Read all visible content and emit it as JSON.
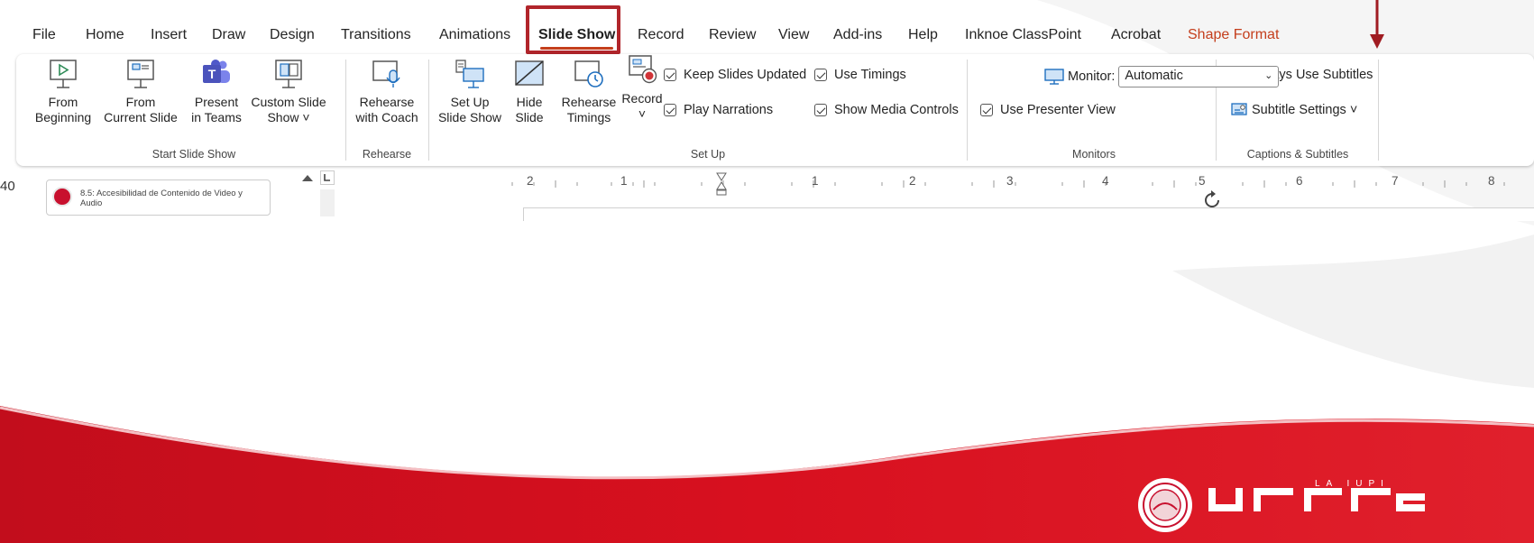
{
  "tabs": [
    {
      "label": "File"
    },
    {
      "label": "Home"
    },
    {
      "label": "Insert"
    },
    {
      "label": "Draw"
    },
    {
      "label": "Design"
    },
    {
      "label": "Transitions"
    },
    {
      "label": "Animations"
    },
    {
      "label": "Slide Show",
      "active": true
    },
    {
      "label": "Record"
    },
    {
      "label": "Review"
    },
    {
      "label": "View"
    },
    {
      "label": "Add-ins"
    },
    {
      "label": "Help"
    },
    {
      "label": "Inknoe ClassPoint"
    },
    {
      "label": "Acrobat"
    },
    {
      "label": "Shape Format"
    }
  ],
  "groups": {
    "start_slide_show": {
      "label": "Start Slide Show",
      "from_beginning": [
        "From",
        "Beginning"
      ],
      "from_current": [
        "From",
        "Current Slide"
      ],
      "present_teams": [
        "Present",
        "in Teams"
      ],
      "custom_show": [
        "Custom Slide",
        "Show ˅"
      ]
    },
    "rehearse": {
      "label": "Rehearse",
      "rehearse_coach": [
        "Rehearse",
        "with Coach"
      ]
    },
    "setup": {
      "label": "Set Up",
      "setup_show": [
        "Set Up",
        "Slide Show"
      ],
      "hide_slide": [
        "Hide",
        "Slide"
      ],
      "rehearse_timings": [
        "Rehearse",
        "Timings"
      ],
      "record": [
        "Record",
        "˅"
      ],
      "keep_updated": "Keep Slides Updated",
      "play_narrations": "Play Narrations",
      "use_timings": "Use Timings",
      "show_media": "Show Media Controls"
    },
    "monitors": {
      "label": "Monitors",
      "monitor_label": "Monitor:",
      "monitor_value": "Automatic",
      "use_presenter": "Use Presenter View"
    },
    "captions": {
      "label": "Captions & Subtitles",
      "always_subtitles": "Always Use Subtitles",
      "subtitle_settings": "Subtitle Settings ˅"
    }
  },
  "slide_panel": {
    "slide_number": "40",
    "thumb_title": "8.5: Accesibilidad de Contenido de Video y Audio"
  },
  "ruler_numbers": [
    "2",
    "1",
    "1",
    "2",
    "3",
    "4",
    "5",
    "6",
    "7",
    "8"
  ],
  "brand": {
    "small": "LA IUPI"
  },
  "colors": {
    "accent": "#c43e1c",
    "highlight": "#b1252b",
    "band": "#d0111f"
  }
}
